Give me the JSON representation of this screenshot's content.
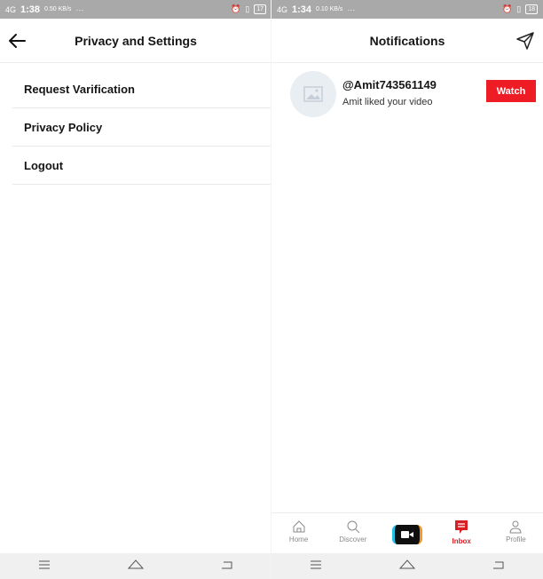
{
  "left": {
    "status": {
      "signal": "4G",
      "time": "1:38",
      "speed": "0.50 KB/s",
      "dots": "···",
      "battery": "17"
    },
    "header": {
      "title": "Privacy and Settings"
    },
    "menu": [
      "Request Varification",
      "Privacy Policy",
      "Logout"
    ]
  },
  "right": {
    "status": {
      "signal": "4G",
      "time": "1:34",
      "speed": "0.10 KB/s",
      "dots": "···",
      "battery": "18"
    },
    "header": {
      "title": "Notifications"
    },
    "notification": {
      "username": "@Amit743561149",
      "text": "Amit liked your video",
      "action": "Watch"
    },
    "bottom_nav": [
      {
        "label": "Home",
        "icon": "home-icon"
      },
      {
        "label": "Discover",
        "icon": "search-icon"
      },
      {
        "label": "",
        "icon": "camera-icon"
      },
      {
        "label": "Inbox",
        "icon": "inbox-icon",
        "active": true
      },
      {
        "label": "Profile",
        "icon": "profile-icon"
      }
    ]
  },
  "colors": {
    "accent": "#ee1c24",
    "statusbar": "#a9a9a9",
    "text": "#161616"
  }
}
